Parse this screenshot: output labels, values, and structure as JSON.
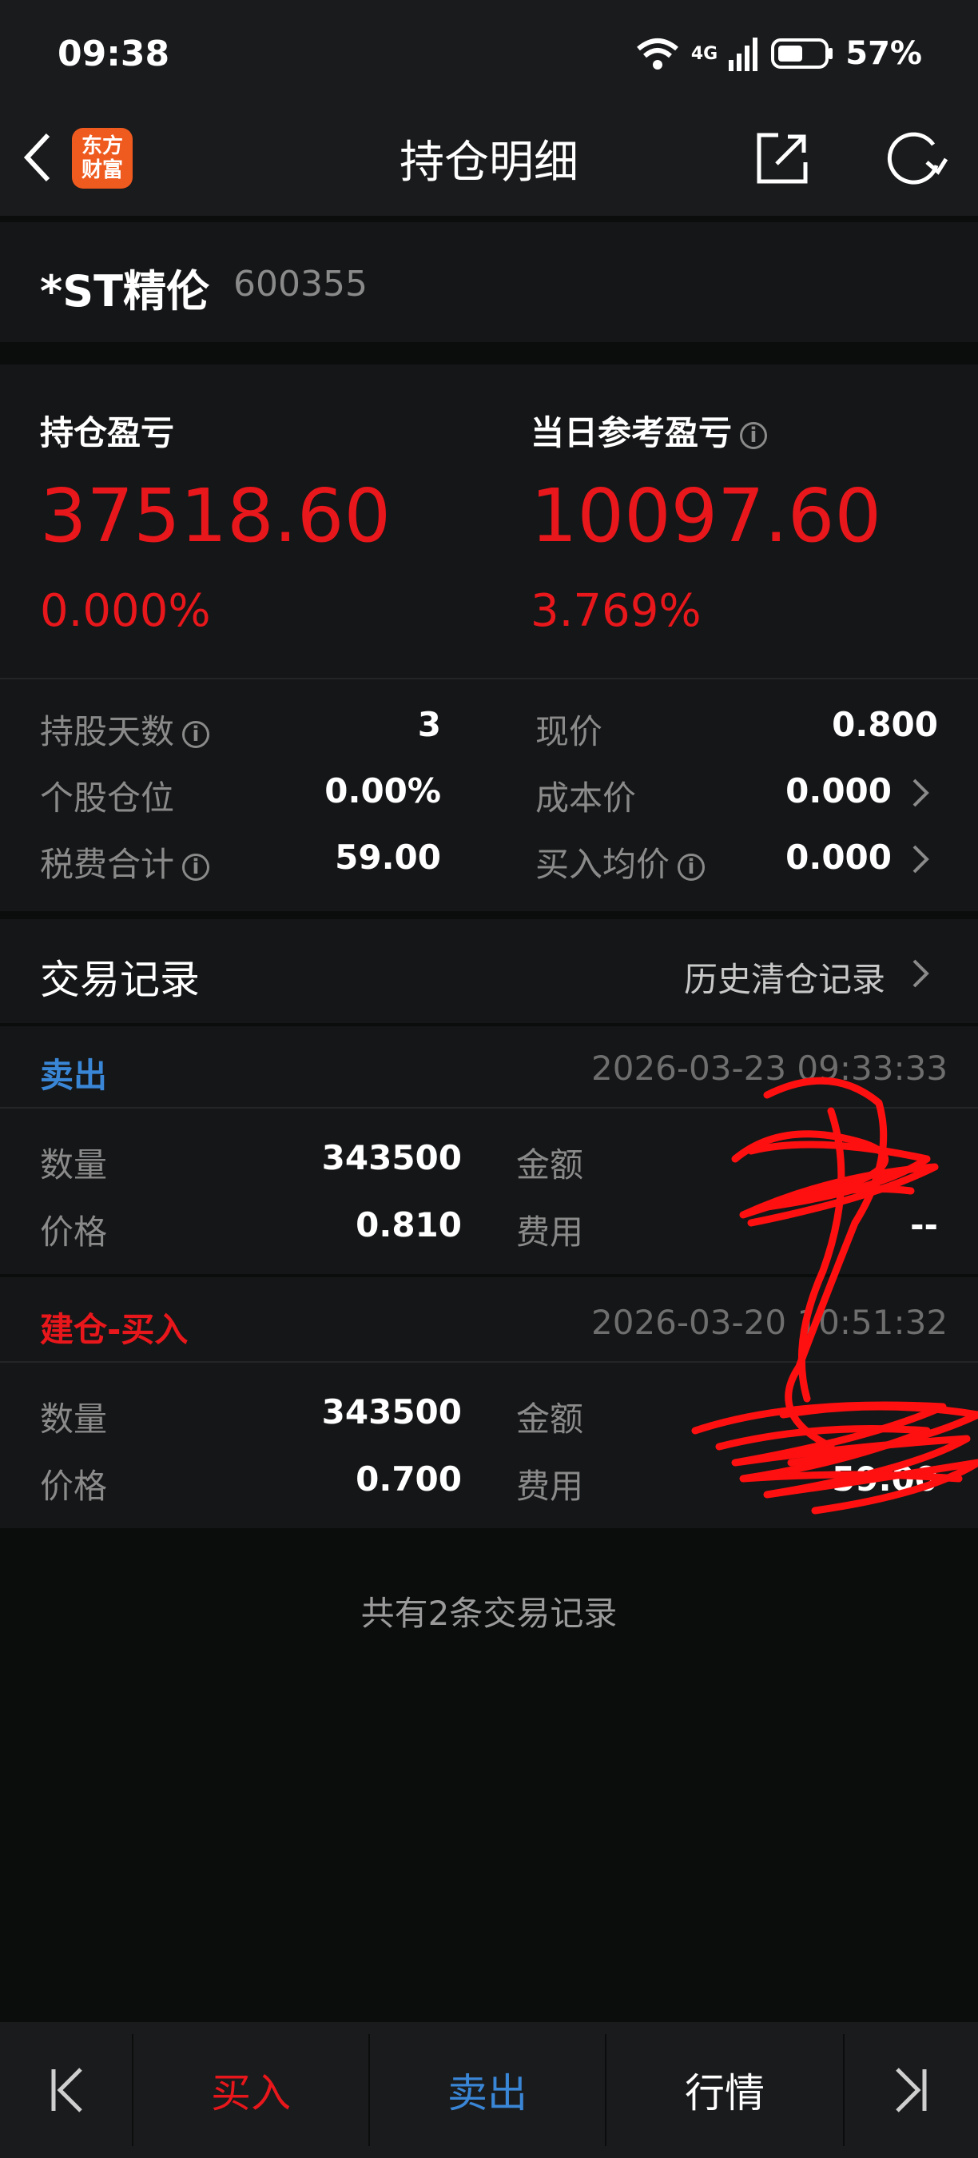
{
  "status_bar": {
    "time": "09:38",
    "network": "4G",
    "battery": "57%"
  },
  "header": {
    "title": "持仓明细",
    "logo_line1": "东方",
    "logo_line2": "财富"
  },
  "stock": {
    "name": "*ST精伦",
    "code": "600355"
  },
  "summary": {
    "position_pl_label": "持仓盈亏",
    "position_pl_value": "37518.60",
    "position_pl_pct": "0.000%",
    "daily_pl_label": "当日参考盈亏",
    "daily_pl_value": "10097.60",
    "daily_pl_pct": "3.769%"
  },
  "details": {
    "days_label": "持股天数",
    "days_value": "3",
    "price_label": "现价",
    "price_value": "0.800",
    "weight_label": "个股仓位",
    "weight_value": "0.00%",
    "cost_label": "成本价",
    "cost_value": "0.000",
    "fees_label": "税费合计",
    "fees_value": "59.00",
    "avg_label": "买入均价",
    "avg_value": "0.000"
  },
  "trades": {
    "title": "交易记录",
    "history_link": "历史清仓记录",
    "records": [
      {
        "type": "卖出",
        "time": "2026-03-23 09:33:33",
        "qty_label": "数量",
        "qty": "343500",
        "amount_label": "金额",
        "price_label": "价格",
        "price": "0.810",
        "fee_label": "费用",
        "fee": "--"
      },
      {
        "type": "建仓-买入",
        "time": "2026-03-20 10:51:32",
        "qty_label": "数量",
        "qty": "343500",
        "amount_label": "金额",
        "price_label": "价格",
        "price": "0.700",
        "fee_label": "费用",
        "fee": "59.00"
      }
    ],
    "summary": "共有2条交易记录"
  },
  "footer": {
    "buy": "买入",
    "sell": "卖出",
    "quote": "行情"
  },
  "colors": {
    "red": "#e8171b",
    "blue": "#3a86d6",
    "background": "#0b0c0c",
    "panel": "#151617"
  }
}
